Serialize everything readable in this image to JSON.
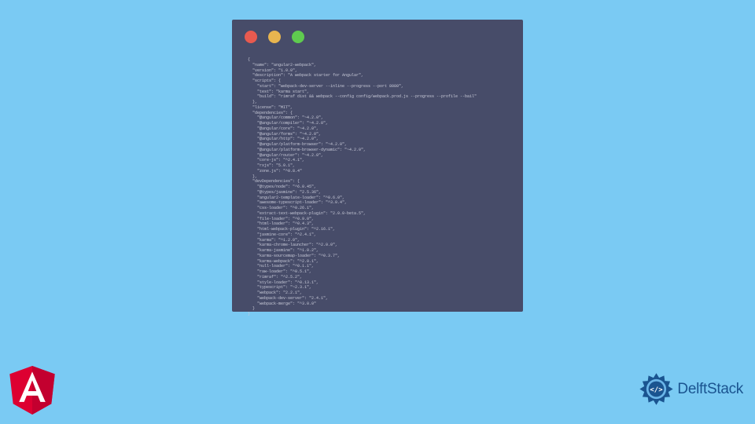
{
  "window": {
    "traffic_colors": {
      "red": "#e85a4f",
      "yellow": "#e8b54f",
      "green": "#5fcb4f"
    }
  },
  "code": {
    "content": "{\n  \"name\": \"angular2-webpack\",\n  \"version\": \"1.0.0\",\n  \"description\": \"A webpack starter for Angular\",\n  \"scripts\": {\n    \"start\": \"webpack-dev-server --inline --progress --port 8080\",\n    \"test\": \"karma start\",\n    \"build\": \"rimraf dist && webpack --config config/webpack.prod.js --progress --profile --bail\"\n  },\n  \"license\": \"MIT\",\n  \"dependencies\": {\n    \"@angular/common\": \"~4.2.0\",\n    \"@angular/compiler\": \"~4.2.0\",\n    \"@angular/core\": \"~4.2.0\",\n    \"@angular/forms\": \"~4.2.0\",\n    \"@angular/http\": \"~4.2.0\",\n    \"@angular/platform-browser\": \"~4.2.0\",\n    \"@angular/platform-browser-dynamic\": \"~4.2.0\",\n    \"@angular/router\": \"~4.2.0\",\n    \"core-js\": \"^2.4.1\",\n    \"rxjs\": \"5.0.1\",\n    \"zone.js\": \"^0.8.4\"\n  },\n  \"devDependencies\": {\n    \"@types/node\": \"^6.0.45\",\n    \"@types/jasmine\": \"2.5.36\",\n    \"angular2-template-loader\": \"^0.6.0\",\n    \"awesome-typescript-loader\": \"^3.0.4\",\n    \"css-loader\": \"^0.26.1\",\n    \"extract-text-webpack-plugin\": \"2.0.0-beta.5\",\n    \"file-loader\": \"^0.9.0\",\n    \"html-loader\": \"^0.4.3\",\n    \"html-webpack-plugin\": \"^2.16.1\",\n    \"jasmine-core\": \"^2.4.1\",\n    \"karma\": \"^1.2.0\",\n    \"karma-chrome-launcher\": \"^2.0.0\",\n    \"karma-jasmine\": \"^1.0.2\",\n    \"karma-sourcemap-loader\": \"^0.3.7\",\n    \"karma-webpack\": \"^2.0.1\",\n    \"null-loader\": \"^0.1.1\",\n    \"raw-loader\": \"^0.5.1\",\n    \"rimraf\": \"^2.5.2\",\n    \"style-loader\": \"^0.13.1\",\n    \"typescript\": \"~2.3.1\",\n    \"webpack\": \"2.2.1\",\n    \"webpack-dev-server\": \"2.4.1\",\n    \"webpack-merge\": \"^3.0.0\"\n  }\n}"
  },
  "logos": {
    "angular_letter": "A",
    "delft_text": "DelftStack"
  }
}
